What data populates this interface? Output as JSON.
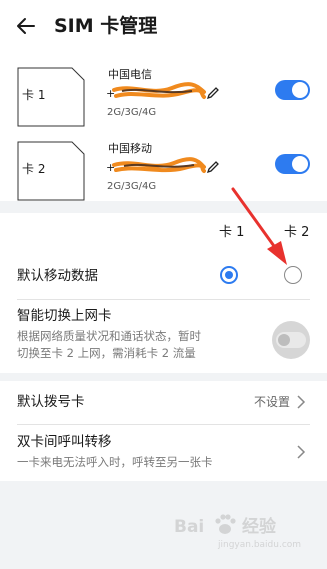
{
  "header": {
    "title": "SIM 卡管理"
  },
  "sims": [
    {
      "slot_label": "卡 1",
      "carrier": "中国电信",
      "number": "+",
      "network": "2G/3G/4G",
      "enabled": true
    },
    {
      "slot_label": "卡 2",
      "carrier": "中国移动",
      "number": "+",
      "network": "2G/3G/4G",
      "enabled": true
    }
  ],
  "settings": {
    "col1": "卡 1",
    "col2": "卡 2",
    "default_data_label": "默认移动数据",
    "default_data_selected": "卡 1",
    "smart_switch_label": "智能切换上网卡",
    "smart_switch_desc_line1": "根据网络质量状况和通话状态，暂时",
    "smart_switch_desc_line2": "切换至卡 2 上网，需消耗卡 2 流量",
    "smart_switch_enabled": false
  },
  "list": {
    "default_dial_label": "默认拨号卡",
    "default_dial_value": "不设置",
    "call_forward_label": "双卡间呼叫转移",
    "call_forward_desc": "一卡来电无法呼入时，呼转至另一张卡"
  },
  "watermark": {
    "text": "Bai",
    "text2": "经验",
    "sub": "jingyan.baidu.com"
  },
  "colors": {
    "accent": "#2d7bf0",
    "annotation_arrow": "#e8322e",
    "scribble": "#f08a1e"
  },
  "icons": [
    "back-arrow-icon",
    "sim-card-icon",
    "edit-pencil-icon",
    "chevron-right-icon",
    "paw-icon"
  ]
}
